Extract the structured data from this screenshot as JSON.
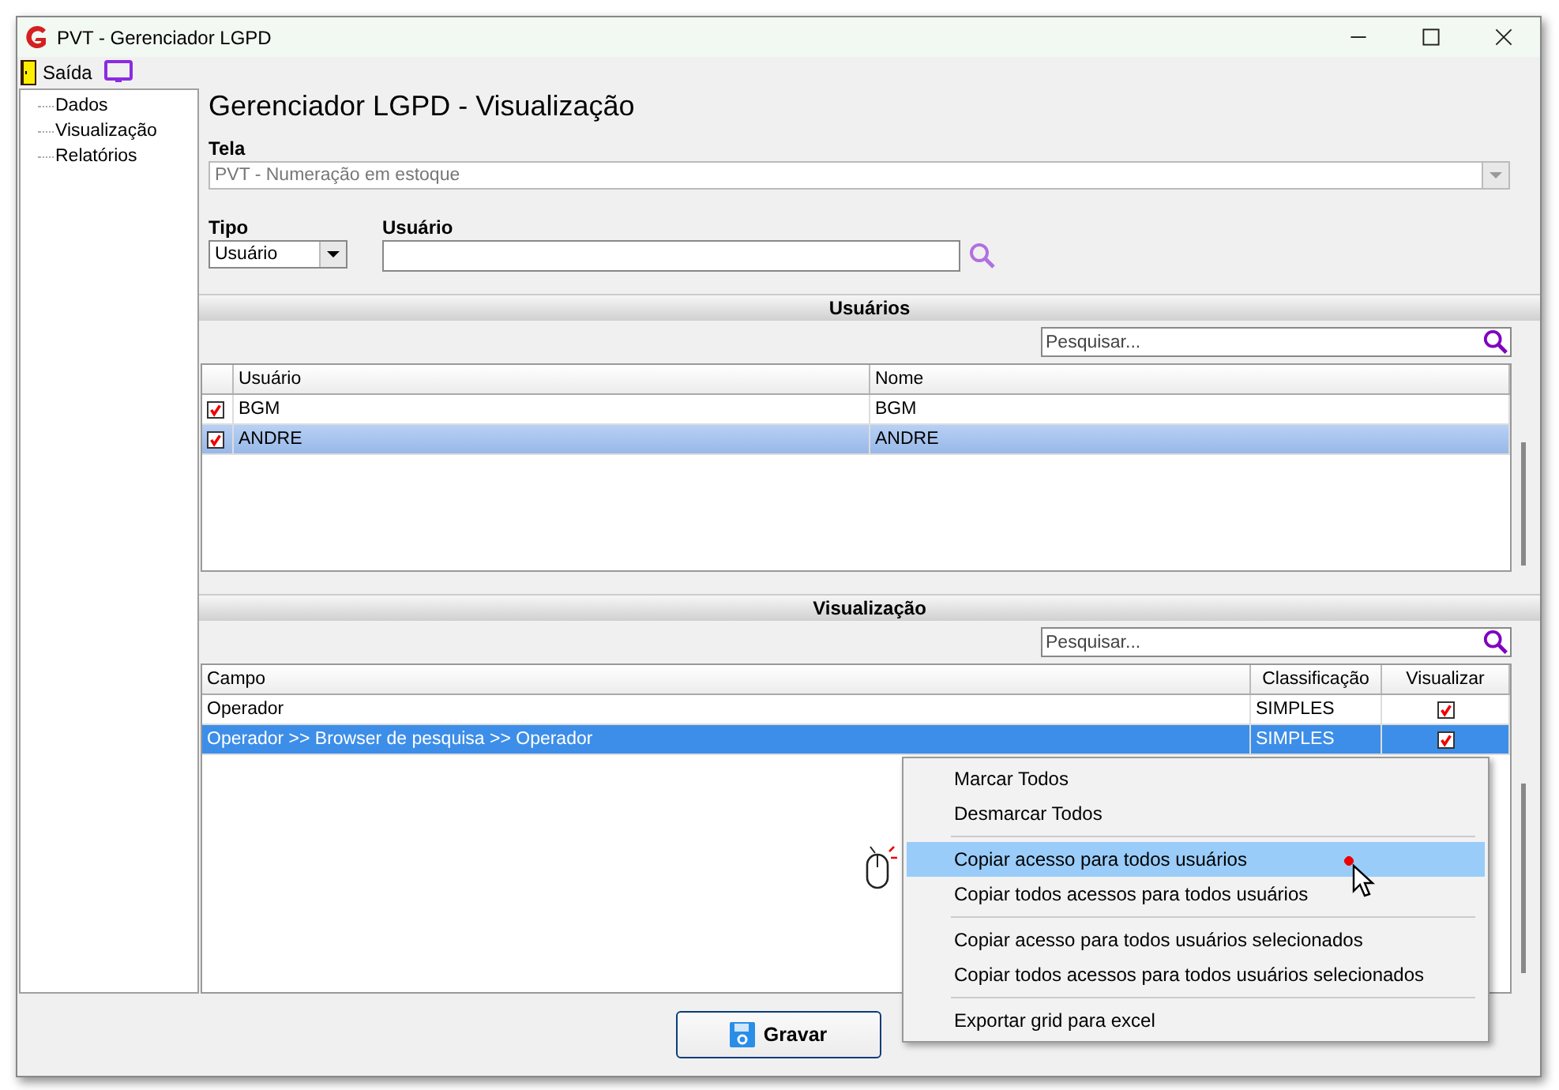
{
  "window": {
    "title": "PVT - Gerenciador LGPD"
  },
  "menu_bar": {
    "items": [
      {
        "label": "Saída"
      }
    ]
  },
  "sidebar": {
    "items": [
      {
        "label": "Dados"
      },
      {
        "label": "Visualização"
      },
      {
        "label": "Relatórios"
      }
    ]
  },
  "page_title": "Gerenciador LGPD - Visualização",
  "tela": {
    "label": "Tela",
    "value": "PVT - Numeração em estoque",
    "disabled": true
  },
  "tipo": {
    "label": "Tipo",
    "value": "Usuário"
  },
  "usuario": {
    "label": "Usuário"
  },
  "users_section": {
    "title": "Usuários",
    "search": {
      "placeholder": "Pesquisar..."
    },
    "columns": [
      "Usuário",
      "Nome"
    ],
    "rows": [
      {
        "checked": true,
        "usuario": "BGM",
        "nome": "BGM",
        "selected": false
      },
      {
        "checked": true,
        "usuario": "ANDRE",
        "nome": "ANDRE",
        "selected": true
      }
    ]
  },
  "view_section": {
    "title": "Visualização",
    "search": {
      "placeholder": "Pesquisar..."
    },
    "columns": [
      "Campo",
      "Classificação",
      "Visualizar"
    ],
    "rows": [
      {
        "campo": "Operador",
        "classificacao": "SIMPLES",
        "visualizar": true,
        "selected": false
      },
      {
        "campo": "Operador >> Browser de pesquisa >> Operador",
        "classificacao": "SIMPLES",
        "visualizar": true,
        "selected": true
      }
    ]
  },
  "context_menu": {
    "items": [
      {
        "kind": "item",
        "label": "Marcar Todos",
        "selected": false
      },
      {
        "kind": "item",
        "label": "Desmarcar Todos",
        "selected": false
      },
      {
        "kind": "separator"
      },
      {
        "kind": "item",
        "label": "Copiar acesso para todos usuários",
        "selected": true
      },
      {
        "kind": "item",
        "label": "Copiar todos acessos para todos usuários",
        "selected": false
      },
      {
        "kind": "separator"
      },
      {
        "kind": "item",
        "label": "Copiar acesso para todos usuários selecionados",
        "selected": false
      },
      {
        "kind": "item",
        "label": "Copiar todos acessos para todos usuários selecionados",
        "selected": false
      },
      {
        "kind": "separator"
      },
      {
        "kind": "item",
        "label": "Exportar grid para excel",
        "selected": false
      }
    ]
  },
  "buttons": [
    {
      "label": "Gravar"
    }
  ]
}
